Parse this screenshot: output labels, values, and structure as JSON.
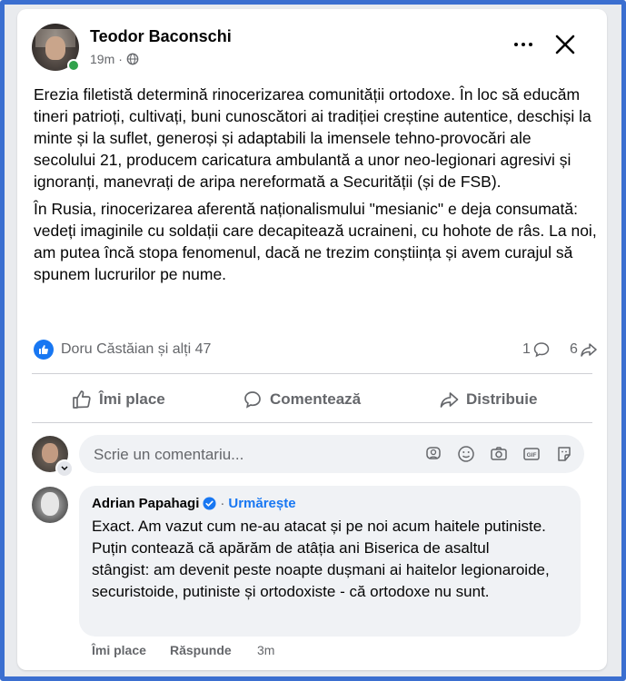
{
  "post": {
    "author": "Teodor Baconschi",
    "time": "19m",
    "separator": "·",
    "paragraphs": [
      "Erezia filetistă determină rinocerizarea comunității ortodoxe. În loc să educăm tineri patrioți, cultivați, buni cunoscători ai tradiției creștine autentice, deschiși la minte și la suflet, generoși și adaptabili la imensele tehno-provocări ale secolului 21, producem caricatura ambulantă a unor neo-legionari agresivi și ignoranți, manevrați de aripa nereformată a Securității (și de FSB).",
      "În Rusia, rinocerizarea aferentă naționalismului \"mesianic\" e deja consumată: vedeți imaginile cu soldații care decapitează ucraineni, cu hohote de râs. La noi, am putea încă stopa fenomenul, dacă ne trezim conștiința și avem curajul să spunem lucrurilor pe nume."
    ],
    "reactions_text": "Doru Căstăian și alți 47",
    "comment_count": "1",
    "share_count": "6"
  },
  "actions": {
    "like": "Îmi place",
    "comment": "Comentează",
    "share": "Distribuie"
  },
  "comment_box": {
    "placeholder": "Scrie un comentariu..."
  },
  "comment": {
    "author": "Adrian Papahagi",
    "separator": "·",
    "follow": "Urmărește",
    "text": "Exact. Am vazut cum ne-au atacat și pe noi acum haitele putiniste. Puțin contează că apărăm de atâția ani Biserica de asaltul stângist: am devenit peste noapte dușmani ai haitelor legionaroide, securistoide, putiniste și ortodoxiste - că ortodoxe nu sunt.",
    "like": "Îmi place",
    "reply": "Răspunde",
    "time": "3m"
  },
  "colors": {
    "accent": "#1877f2",
    "secondary_text": "#65676b",
    "frame": "#3b6fd0"
  }
}
